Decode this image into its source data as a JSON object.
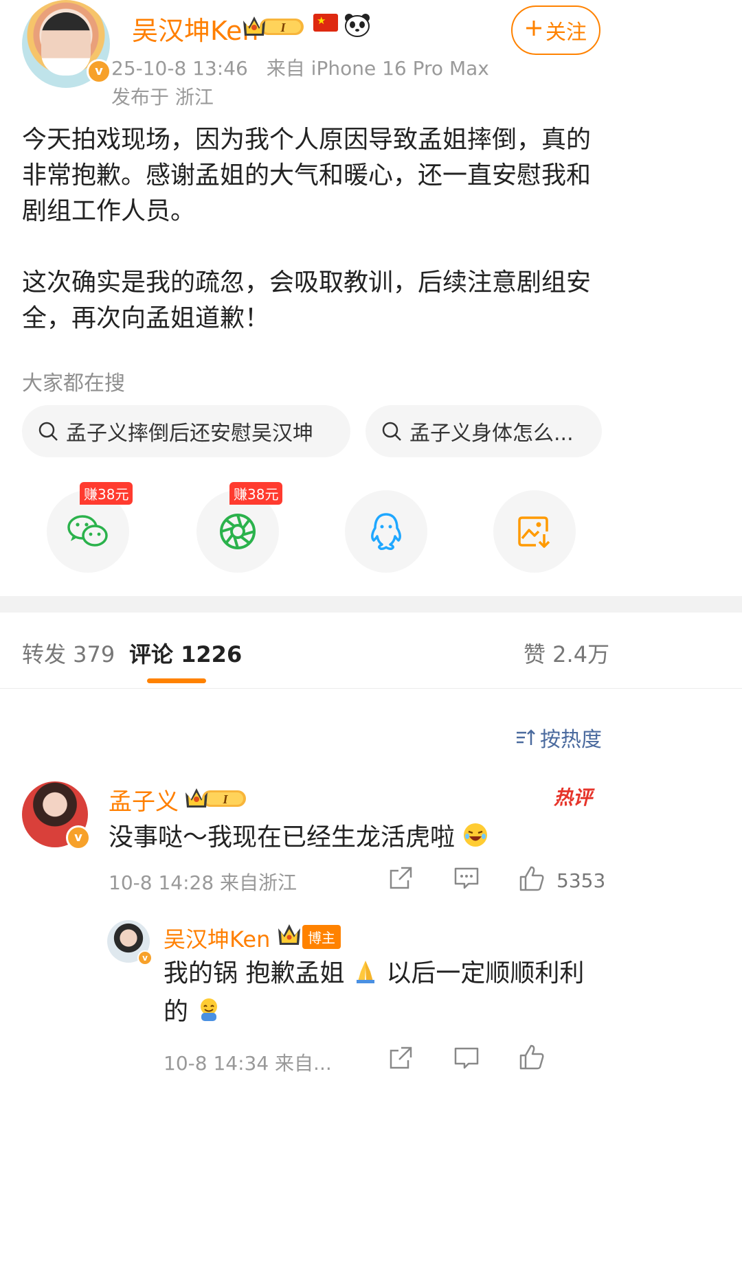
{
  "author": {
    "name": "吴汉坤Ken",
    "level_badge": "I",
    "verified_mark": "v",
    "timestamp": "25-10-8 13:46",
    "source": "来自 iPhone 16 Pro Max",
    "location": "发布于 浙江",
    "follow_label": "关注"
  },
  "post": {
    "paragraph1": "今天拍戏现场，因为我个人原因导致孟姐摔倒，真的非常抱歉。感谢孟姐的大气和暖心，还一直安慰我和剧组工作人员。",
    "paragraph2": "这次确实是我的疏忽，会吸取教训，后续注意剧组安全，再次向孟姐道歉！"
  },
  "search": {
    "title": "大家都在搜",
    "items": [
      "孟子义摔倒后还安慰吴汉坤",
      "孟子义身体怎么..."
    ]
  },
  "share": {
    "badge_label": "赚38元",
    "icons": [
      "wechat-icon",
      "moments-icon",
      "qq-icon",
      "save-image-icon"
    ]
  },
  "tabs": {
    "repost": "转发 379",
    "comments": "评论 1226",
    "likes": "赞 2.4万"
  },
  "sort_label": "按热度",
  "comment": {
    "name": "孟子义",
    "level_badge": "I",
    "hot_label": "热评",
    "text": "没事哒～我现在已经生龙活虎啦",
    "meta": "10-8 14:28  来自浙江",
    "like_count": "5353"
  },
  "reply": {
    "name": "吴汉坤Ken",
    "badge": "博主",
    "text_part1": "我的锅 抱歉孟姐",
    "text_part2": " 以后一定顺顺利利的",
    "meta": "10-8 14:34  来自..."
  },
  "colors": {
    "brand_orange": "#ff8200",
    "name_orange": "#ff7f00",
    "badge_red": "#ff3b2f",
    "link_blue": "#4a6a9e"
  }
}
